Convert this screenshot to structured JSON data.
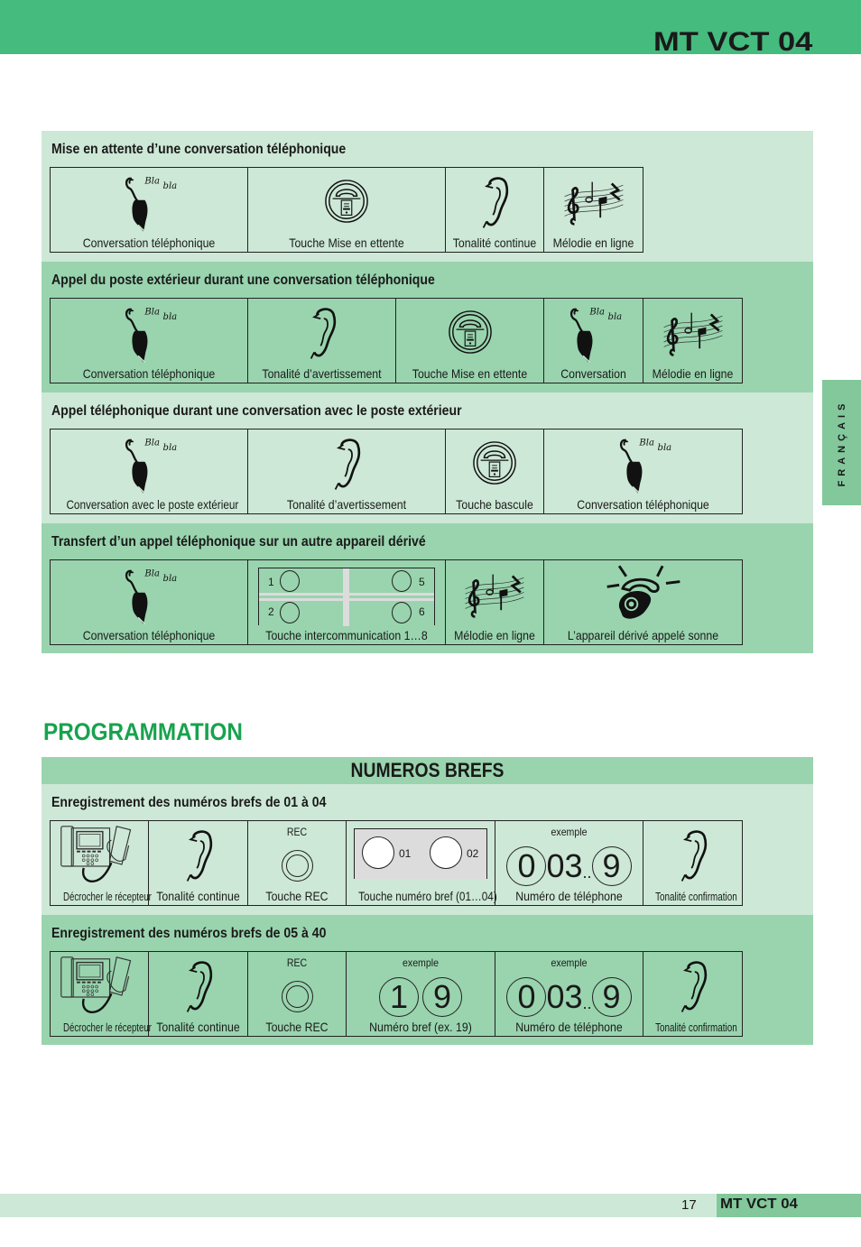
{
  "header": {
    "title": "MT VCT 04",
    "accent_color": "#45bb7e"
  },
  "side_tab": {
    "label": "FRANÇAIS"
  },
  "sections": [
    {
      "title": "Mise en attente d’une conversation téléphonique",
      "cells": [
        {
          "icon": "phone-conversation-icon",
          "label": "Conversation téléphonique"
        },
        {
          "icon": "hold-button-icon",
          "label": "Touche Mise en ettente"
        },
        {
          "icon": "ear-icon",
          "label": "Tonalité continue"
        },
        {
          "icon": "music-melody-icon",
          "label": "Mélodie en ligne"
        }
      ]
    },
    {
      "title": "Appel du poste extérieur durant une conversation téléphonique",
      "cells": [
        {
          "icon": "phone-conversation-icon",
          "label": "Conversation téléphonique"
        },
        {
          "icon": "ear-icon",
          "label": "Tonalité d’avertissement"
        },
        {
          "icon": "hold-button-icon",
          "label": "Touche Mise en ettente"
        },
        {
          "icon": "phone-conversation-icon",
          "label": "Conversation"
        },
        {
          "icon": "music-melody-icon",
          "label": "Mélodie en ligne"
        }
      ]
    },
    {
      "title": "Appel téléphonique durant une conversation avec le poste extérieur",
      "cells": [
        {
          "icon": "phone-conversation-icon",
          "label": "Conversation avec le poste extérieur"
        },
        {
          "icon": "ear-icon",
          "label": "Tonalité d’avertissement"
        },
        {
          "icon": "hold-button-icon",
          "label": "Touche bascule"
        },
        {
          "icon": "phone-conversation-icon",
          "label": "Conversation téléphonique"
        }
      ]
    },
    {
      "title": "Transfert d’un appel téléphonique sur un autre appareil dérivé",
      "cells": [
        {
          "icon": "phone-conversation-icon",
          "label": "Conversation téléphonique"
        },
        {
          "icon": "intercom-keys-icon",
          "label": "Touche intercommunication 1…8",
          "keys": [
            "1",
            "2",
            "5",
            "6"
          ]
        },
        {
          "icon": "music-melody-icon",
          "label": "Mélodie en ligne"
        },
        {
          "icon": "ringing-phone-icon",
          "label": "L’appareil dérivé appelé sonne"
        }
      ]
    }
  ],
  "programmation": {
    "title": "PROGRAMMATION",
    "subtitle": "NUMEROS BREFS",
    "blocks": [
      {
        "title": "Enregistrement des numéros brefs de 01 à 04",
        "cells": [
          {
            "icon": "handset-lift-icon",
            "label": "Décrocher le récepteur"
          },
          {
            "icon": "ear-icon",
            "label": "Tonalité continue"
          },
          {
            "icon": "rec-button-icon",
            "top": "REC",
            "label": "Touche REC"
          },
          {
            "icon": "speed-dial-keys-icon",
            "label": "Touche numéro bref (01…04)",
            "keys": [
              "01",
              "02"
            ]
          },
          {
            "icon": "phone-number-example",
            "top": "exemple",
            "digits": [
              "0",
              "0",
              "3",
              "..",
              "9"
            ],
            "label": "Numéro de téléphone"
          },
          {
            "icon": "ear-icon",
            "label": "Tonalité confirmation"
          }
        ]
      },
      {
        "title": "Enregistrement des numéros brefs de 05 à 40",
        "cells": [
          {
            "icon": "handset-lift-icon",
            "label": "Décrocher le récepteur"
          },
          {
            "icon": "ear-icon",
            "label": "Tonalité continue"
          },
          {
            "icon": "rec-button-icon",
            "top": "REC",
            "label": "Touche REC"
          },
          {
            "icon": "speed-dial-example",
            "top": "exemple",
            "digits": [
              "1",
              "9"
            ],
            "label": "Numéro bref  (ex. 19)"
          },
          {
            "icon": "phone-number-example",
            "top": "exemple",
            "digits": [
              "0",
              "0",
              "3",
              "..",
              "9"
            ],
            "label": "Numéro de téléphone"
          },
          {
            "icon": "ear-icon",
            "label": "Tonalité confirmation"
          }
        ]
      }
    ]
  },
  "footer": {
    "page_number": "17",
    "title": "MT VCT 04"
  }
}
